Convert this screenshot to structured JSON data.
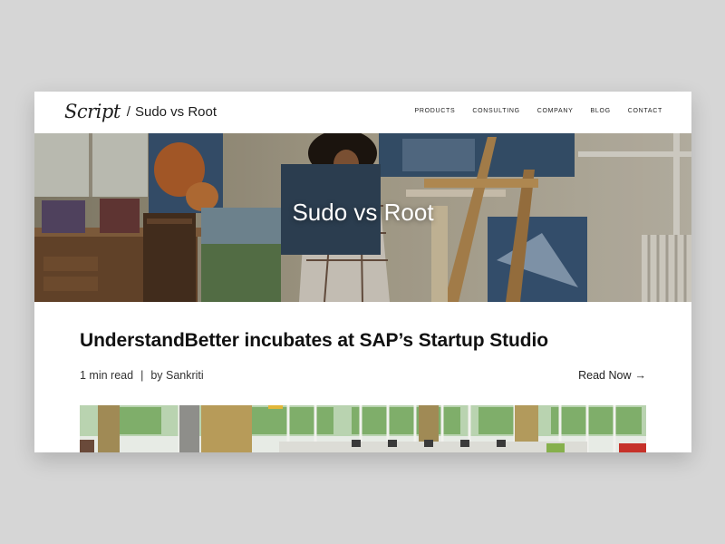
{
  "header": {
    "logo_text": "Script",
    "separator": "/",
    "site_title": "Sudo vs Root",
    "nav": [
      {
        "label": "PRODUCTS"
      },
      {
        "label": "CONSULTING"
      },
      {
        "label": "COMPANY"
      },
      {
        "label": "BLOG"
      },
      {
        "label": "CONTACT"
      }
    ]
  },
  "hero": {
    "title": "Sudo vs Root"
  },
  "post": {
    "title": "UnderstandBetter incubates at SAP’s Startup Studio",
    "read_time": "1 min read",
    "divider": "|",
    "author": "by Sankriti",
    "read_now_label": "Read Now",
    "read_now_arrow": "→"
  },
  "colors": {
    "page_background": "#d6d6d6",
    "card_background": "#ffffff",
    "text": "#111111"
  }
}
